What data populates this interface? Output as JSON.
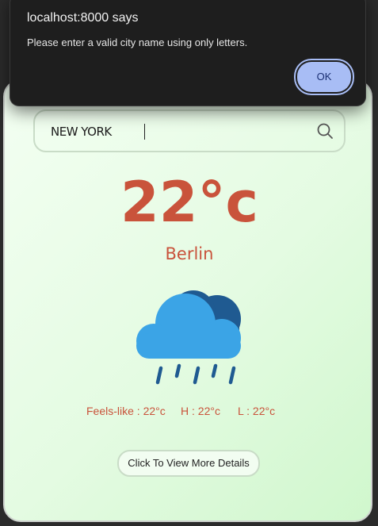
{
  "dialog": {
    "title": "localhost:8000 says",
    "message": "Please enter a valid city name using only letters.",
    "ok_label": "OK"
  },
  "search": {
    "value": "NEW YORK",
    "icon": "search-icon"
  },
  "weather": {
    "temperature": "22°c",
    "city": "Berlin",
    "icon": "rain-cloud-icon",
    "feels_like": "Feels-like : 22°c",
    "high": "H : 22°c",
    "low": "L : 22°c"
  },
  "details_button": {
    "label": "Click To View More Details"
  },
  "colors": {
    "accent": "#c9533b",
    "cloud_front": "#3ba4e6",
    "cloud_back": "#1f5a91",
    "dialog_bg": "#1e1e1e",
    "ok_button": "#a8bdf5"
  }
}
